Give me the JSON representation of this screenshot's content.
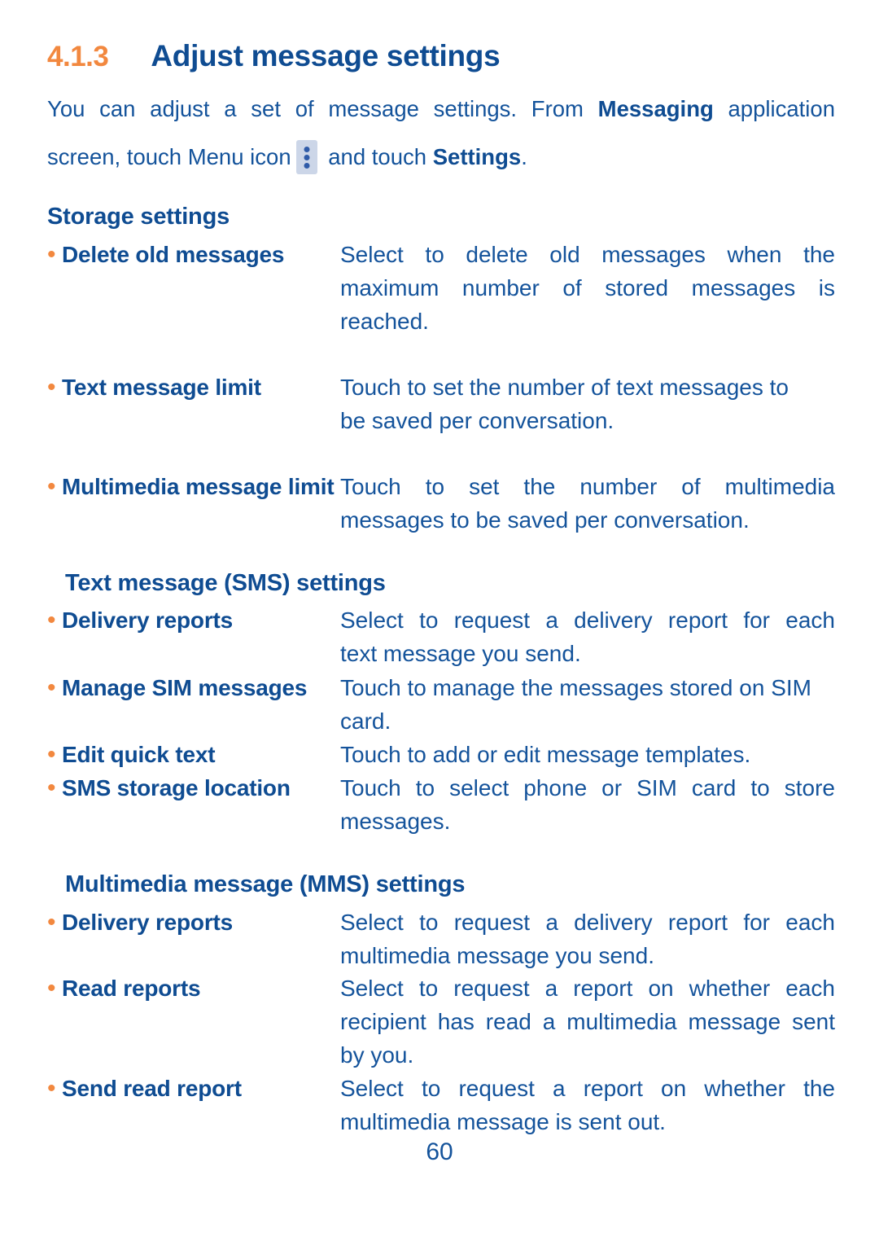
{
  "document": {
    "heading": {
      "number": "4.1.3",
      "title": "Adjust message settings"
    },
    "intro": {
      "line1_a": "You can adjust a set of message settings. From ",
      "line1_b": "Messaging",
      "line1_c": " application",
      "line2_a": "screen, touch Menu icon",
      "line2_b": " and touch ",
      "line2_c": "Settings",
      "line2_d": ".",
      "menu_icon_name": "kebab-menu-icon"
    },
    "sections": [
      {
        "title": "Storage settings",
        "items": [
          {
            "bullet": "•",
            "term_line1": "Delete old",
            "term_line2": "messages",
            "desc_line1": "Select to delete old messages when the",
            "desc_line2": "maximum number of stored messages is",
            "desc_line3": "reached."
          },
          {
            "bullet": "•",
            "term_line1": "Text message limit",
            "term_line2": "",
            "desc_line1": "Touch to set the number of text messages to",
            "desc_line2": "be saved per conversation.",
            "desc_line3": ""
          },
          {
            "bullet": "•",
            "term_line1": "Multimedia",
            "term_line2": "message limit",
            "desc_line1": "Touch to set the number of multimedia",
            "desc_line2": "messages to be saved per conversation.",
            "desc_line3": ""
          }
        ]
      },
      {
        "title": "Text message (SMS) settings",
        "items": [
          {
            "bullet": "•",
            "term_line1": "Delivery reports",
            "term_line2": "",
            "desc_line1": "Select to request a delivery report for each",
            "desc_line2": "text message you send.",
            "desc_line3": ""
          },
          {
            "bullet": "•",
            "term_line1": "Manage SIM",
            "term_line2": "messages",
            "desc_line1": "Touch to manage the messages stored on SIM",
            "desc_line2": "card.",
            "desc_line3": ""
          },
          {
            "bullet": "•",
            "term_line1": "Edit quick text",
            "term_line2": "",
            "desc_line1": "Touch to add or edit message templates.",
            "desc_line2": "",
            "desc_line3": ""
          },
          {
            "bullet": "•",
            "term_line1": "SMS storage",
            "term_line2": "location",
            "desc_line1": "Touch to select phone or SIM card to store",
            "desc_line2": "messages.",
            "desc_line3": ""
          }
        ]
      },
      {
        "title": "Multimedia message (MMS) settings",
        "items": [
          {
            "bullet": "•",
            "term_line1": "Delivery reports",
            "term_line2": "",
            "desc_line1": "Select to request a delivery report for each",
            "desc_line2": "multimedia message you send.",
            "desc_line3": ""
          },
          {
            "bullet": "•",
            "term_line1": "Read reports",
            "term_line2": "",
            "desc_line1": "Select to request a report on whether each",
            "desc_line2": "recipient has read a multimedia message sent",
            "desc_line3": "by you."
          },
          {
            "bullet": "•",
            "term_line1": "Send read report",
            "term_line2": "",
            "desc_line1": "Select to request a report on whether the",
            "desc_line2": "multimedia message is sent out.",
            "desc_line3": ""
          }
        ]
      }
    ],
    "page_number": "60",
    "colors": {
      "accent_orange": "#f2883f",
      "heading_blue": "#0f4c92",
      "body_blue": "#14539b",
      "icon_bg": "#ccd6e8"
    }
  }
}
